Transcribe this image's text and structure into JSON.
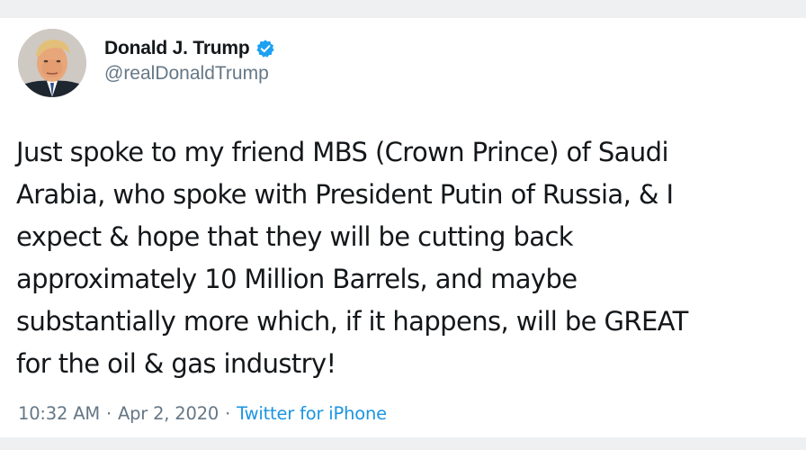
{
  "author": {
    "display_name": "Donald J. Trump",
    "handle": "@realDonaldTrump",
    "verified": true
  },
  "tweet": {
    "text": "Just spoke to my friend MBS (Crown Prince) of Saudi\nArabia, who spoke with President Putin of Russia, & I\nexpect & hope that they will be cutting back\napproximately 10 Million Barrels, and maybe\nsubstantially more which, if it happens, will be GREAT\nfor the oil & gas industry!"
  },
  "meta": {
    "time": "10:32 AM",
    "separator": "·",
    "date": "Apr 2, 2020",
    "source": "Twitter for iPhone"
  },
  "colors": {
    "text": "#14171a",
    "secondary": "#657786",
    "link": "#1b95e0",
    "verified": "#1da1f2"
  },
  "icons": {
    "verified": "verified-badge-icon",
    "avatar": "profile-photo"
  }
}
